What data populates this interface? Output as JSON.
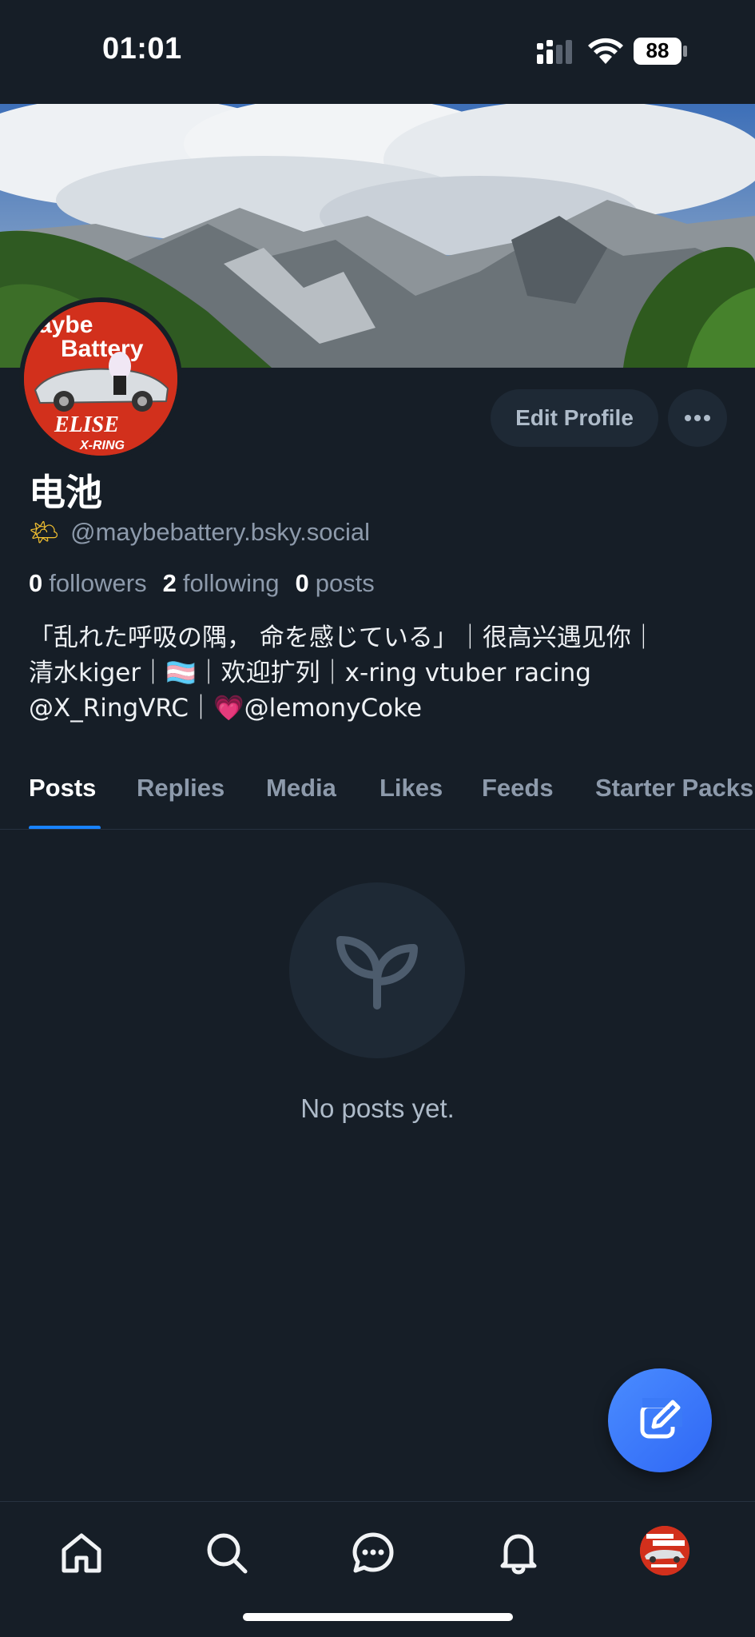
{
  "status_bar": {
    "time": "01:01",
    "battery": "88"
  },
  "profile": {
    "display_name": "电池",
    "handle_emoji": "🌤",
    "handle": "@maybebattery.bsky.social",
    "stats": {
      "followers_count": "0",
      "followers_label": "followers",
      "following_count": "2",
      "following_label": "following",
      "posts_count": "0",
      "posts_label": "posts"
    },
    "bio": "「乱れた呼吸の隅，  命を感じている」｜很高兴遇见你｜\n清水kiger｜🏳️‍⚧️｜欢迎扩列｜x-ring vtuber racing\n@X_RingVRC｜💗@lemonyCoke",
    "avatar_text": {
      "line1": "aybe",
      "line2": "Battery",
      "line3": "ELISE",
      "line4": "X-RING"
    }
  },
  "actions": {
    "edit_profile_label": "Edit Profile"
  },
  "tabs": [
    {
      "label": "Posts",
      "active": true
    },
    {
      "label": "Replies"
    },
    {
      "label": "Media"
    },
    {
      "label": "Likes"
    },
    {
      "label": "Feeds"
    },
    {
      "label": "Starter Packs"
    }
  ],
  "empty_state": {
    "message": "No posts yet.",
    "icon": "sprout-icon"
  },
  "nav": [
    "home-icon",
    "search-icon",
    "chat-icon",
    "bell-icon",
    "profile-avatar"
  ],
  "colors": {
    "background": "#161e27",
    "accent": "#1883ff",
    "fab": "#3b7af7"
  }
}
